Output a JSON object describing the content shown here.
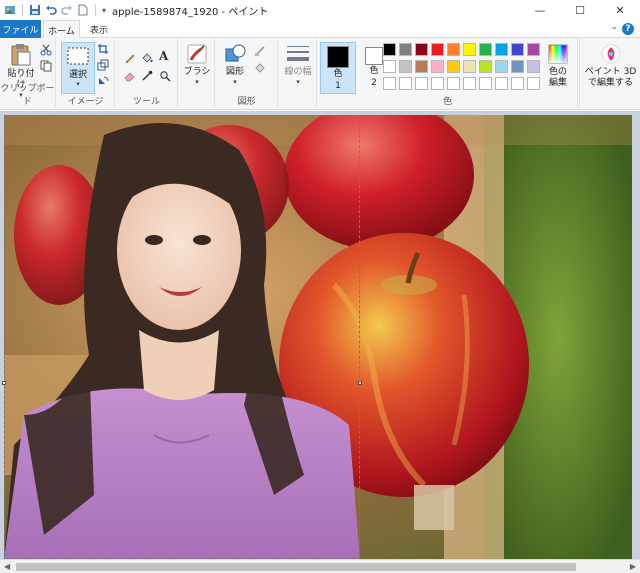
{
  "window": {
    "title": "apple-1589874_1920 - ペイント",
    "controls": [
      "—",
      "☐",
      "✕"
    ]
  },
  "tabs": {
    "file": "ファイル",
    "home": "ホーム",
    "view": "表示"
  },
  "ribbon": {
    "clipboard": {
      "paste": "貼り付け",
      "group": "クリップボード"
    },
    "image": {
      "select": "選択",
      "group": "イメージ"
    },
    "tools": {
      "group": "ツール"
    },
    "brush": {
      "label": "ブラシ"
    },
    "shapes": {
      "label": "図形",
      "group": "図形"
    },
    "size": {
      "label": "線の幅"
    },
    "colors": {
      "color1": "色",
      "color1_num": "1",
      "color2": "色",
      "color2_num": "2",
      "edit": "色の\n編集",
      "edit_line1": "色の",
      "edit_line2": "編集",
      "group": "色"
    },
    "paint3d": {
      "line1": "ペイント 3D",
      "line2": "で編集する"
    }
  },
  "palette": {
    "row1": [
      "#000000",
      "#7f7f7f",
      "#880015",
      "#ed1c24",
      "#ff7f27",
      "#fff200",
      "#22b14c",
      "#00a2e8",
      "#3f48cc",
      "#a349a4"
    ],
    "row2": [
      "#ffffff",
      "#c3c3c3",
      "#b97a57",
      "#ffaec9",
      "#ffc90e",
      "#efe4b0",
      "#b5e61d",
      "#99d9ea",
      "#7092be",
      "#c8bfe7"
    ],
    "row3": [
      "#ffffff",
      "#ffffff",
      "#ffffff",
      "#ffffff",
      "#ffffff",
      "#ffffff",
      "#ffffff",
      "#ffffff",
      "#ffffff",
      "#ffffff"
    ],
    "color1": "#000000",
    "color2": "#ffffff"
  },
  "canvas": {
    "accent": "#1979ca"
  }
}
